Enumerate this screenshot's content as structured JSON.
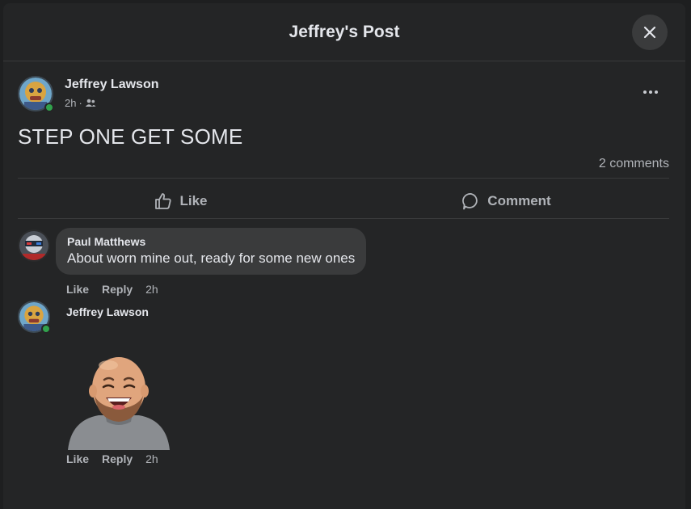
{
  "modal": {
    "title": "Jeffrey's Post"
  },
  "post": {
    "author": "Jeffrey Lawson",
    "time": "2h",
    "separator": "·",
    "audience_icon": "friends-icon",
    "text": "STEP ONE GET SOME",
    "comments_count": "2 comments",
    "actions": {
      "like_label": "Like",
      "comment_label": "Comment"
    }
  },
  "comments": [
    {
      "author": "Paul Matthews",
      "text": "About worn mine out, ready for some new ones",
      "like_label": "Like",
      "reply_label": "Reply",
      "time": "2h"
    },
    {
      "author": "Jeffrey Lawson",
      "attachment": "memoji-laughing-sticker",
      "like_label": "Like",
      "reply_label": "Reply",
      "time": "2h"
    }
  ],
  "colors": {
    "background": "#242526",
    "bubble": "#3a3b3c",
    "online": "#31a24c",
    "secondary_text": "#b0b3b8"
  }
}
